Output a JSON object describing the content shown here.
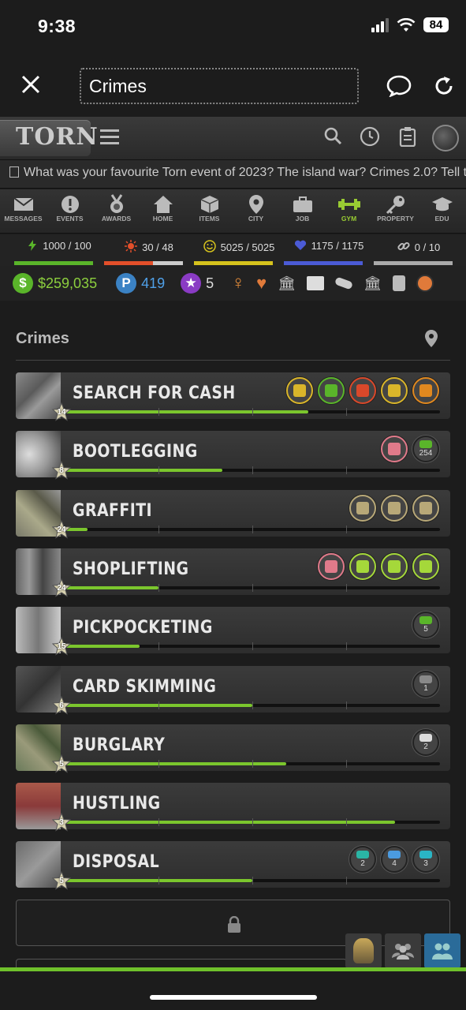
{
  "status": {
    "time": "9:38",
    "battery": "84"
  },
  "browser": {
    "url_title": "Crimes"
  },
  "torn": {
    "logo": "TORN"
  },
  "ticker": {
    "text": "What was your favourite Torn event of 2023? The island war? Crimes 2.0? Tell t"
  },
  "nav": [
    {
      "label": "MESSAGES",
      "icon": "envelope-icon"
    },
    {
      "label": "EVENTS",
      "icon": "alert-icon"
    },
    {
      "label": "AWARDS",
      "icon": "medal-icon"
    },
    {
      "label": "HOME",
      "icon": "house-icon"
    },
    {
      "label": "ITEMS",
      "icon": "box-icon"
    },
    {
      "label": "CITY",
      "icon": "map-pin-icon"
    },
    {
      "label": "JOB",
      "icon": "briefcase-icon"
    },
    {
      "label": "GYM",
      "icon": "dumbbell-icon"
    },
    {
      "label": "PROPERTY",
      "icon": "key-icon"
    },
    {
      "label": "EDU",
      "icon": "graduation-icon"
    }
  ],
  "bars": [
    {
      "label": "1000 / 100",
      "icon": "energy-icon",
      "color": "#5ab52a",
      "fraction": 1.0
    },
    {
      "label": "30 / 48",
      "icon": "nerve-icon",
      "color": "#e34f2a",
      "fraction": 0.62
    },
    {
      "label": "5025 / 5025",
      "icon": "happy-icon",
      "color": "#d6c21d",
      "fraction": 1.0
    },
    {
      "label": "1175 / 1175",
      "icon": "life-icon",
      "color": "#4b5bd6",
      "fraction": 1.0
    },
    {
      "label": "0 / 10",
      "icon": "chain-icon",
      "color": "#aaaaaa",
      "fraction": 1.0
    }
  ],
  "money": {
    "cash": "$259,035",
    "points": "419",
    "merits": "5",
    "points_symbol": "P",
    "cash_symbol": "$"
  },
  "page": {
    "title": "Crimes"
  },
  "crimes": [
    {
      "name": "SEARCH FOR CASH",
      "level": "14",
      "progress": 0.65,
      "icons": [
        {
          "name": "trash-icon",
          "color": "#d9b52a",
          "count": ""
        },
        {
          "name": "crowd-icon",
          "color": "#5ab52a",
          "count": ""
        },
        {
          "name": "subway-icon",
          "color": "#d9482a",
          "count": ""
        },
        {
          "name": "river-icon",
          "color": "#d9b52a",
          "count": ""
        },
        {
          "name": "beach-icon",
          "color": "#e0881f",
          "count": ""
        }
      ]
    },
    {
      "name": "BOOTLEGGING",
      "level": "8",
      "progress": 0.42,
      "icons": [
        {
          "name": "disk-stack-icon",
          "color": "#e07a8a",
          "count": ""
        },
        {
          "name": "coin-stack-icon",
          "color": "#5ab52a",
          "count": "254"
        }
      ]
    },
    {
      "name": "GRAFFITI",
      "level": "24",
      "progress": 0.06,
      "icons": [
        {
          "name": "city-block-icon",
          "color": "#b8a878",
          "count": ""
        },
        {
          "name": "city-block-icon",
          "color": "#b8a878",
          "count": ""
        },
        {
          "name": "city-block-icon",
          "color": "#b8a878",
          "count": ""
        }
      ]
    },
    {
      "name": "SHOPLIFTING",
      "level": "24",
      "progress": 0.25,
      "icons": [
        {
          "name": "candy-icon",
          "color": "#e07a8a",
          "count": ""
        },
        {
          "name": "no-camera-icon",
          "color": "#a5d83a",
          "count": ""
        },
        {
          "name": "no-camera-icon",
          "color": "#a5d83a",
          "count": ""
        },
        {
          "name": "no-guard-icon",
          "color": "#a5d83a",
          "count": ""
        }
      ]
    },
    {
      "name": "PICKPOCKETING",
      "level": "15",
      "progress": 0.2,
      "icons": [
        {
          "name": "person-icon",
          "color": "#5ab52a",
          "count": "5"
        }
      ]
    },
    {
      "name": "CARD SKIMMING",
      "level": "6",
      "progress": 0.5,
      "icons": [
        {
          "name": "keypad-icon",
          "color": "#888888",
          "count": "1"
        }
      ]
    },
    {
      "name": "BURGLARY",
      "level": "5",
      "progress": 0.59,
      "icons": [
        {
          "name": "question-icon",
          "color": "#dddddd",
          "count": "2"
        }
      ]
    },
    {
      "name": "HUSTLING",
      "level": "3",
      "progress": 0.88,
      "icons": []
    },
    {
      "name": "DISPOSAL",
      "level": "5",
      "progress": 0.5,
      "icons": [
        {
          "name": "bricks-icon",
          "color": "#2ab5a5",
          "count": "2"
        },
        {
          "name": "chair-icon",
          "color": "#4b9be0",
          "count": "4"
        },
        {
          "name": "tv-icon",
          "color": "#2ab5c5",
          "count": "3"
        }
      ]
    }
  ]
}
